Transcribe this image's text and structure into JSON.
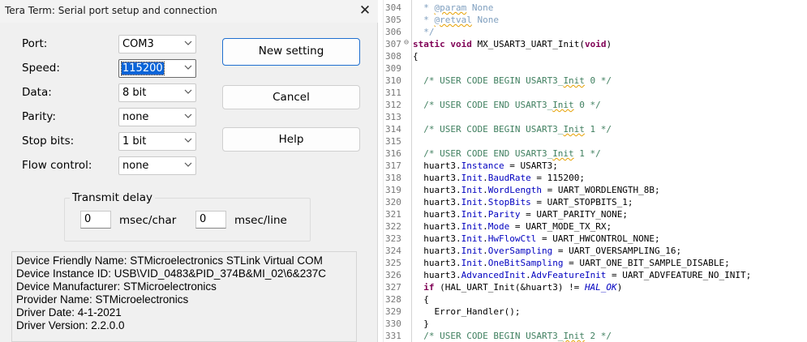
{
  "dialog": {
    "title": "Tera Term: Serial port setup and connection",
    "close_glyph": "✕",
    "fields": [
      {
        "label": "Port:",
        "value": "COM3"
      },
      {
        "label": "Speed:",
        "value": "115200"
      },
      {
        "label": "Data:",
        "value": "8 bit"
      },
      {
        "label": "Parity:",
        "value": "none"
      },
      {
        "label": "Stop bits:",
        "value": "1 bit"
      },
      {
        "label": "Flow control:",
        "value": "none"
      }
    ],
    "buttons": {
      "new_setting": "New setting",
      "cancel": "Cancel",
      "help": "Help"
    },
    "transmit_delay": {
      "title": "Transmit delay",
      "char_value": "0",
      "char_unit": "msec/char",
      "line_value": "0",
      "line_unit": "msec/line"
    },
    "device_info": [
      "Device Friendly Name: STMicroelectronics STLink Virtual COM",
      "Device Instance ID: USB\\VID_0483&PID_374B&MI_02\\6&237C",
      "Device Manufacturer: STMicroelectronics",
      "Provider Name: STMicroelectronics",
      "Driver Date: 4-1-2021",
      "Driver Version: 2.2.0.0"
    ]
  },
  "editor": {
    "line_numbers": [
      "304",
      "305",
      "306",
      "307",
      "308",
      "309",
      "310",
      "311",
      "312",
      "313",
      "314",
      "315",
      "316",
      "317",
      "318",
      "319",
      "320",
      "321",
      "322",
      "323",
      "324",
      "325",
      "326",
      "327",
      "328",
      "329",
      "330",
      "331"
    ],
    "fold_marker": "⊖",
    "lines": {
      "l304_a": "  * ",
      "l304_b": "@param",
      "l304_c": " None",
      "l305_a": "  * ",
      "l305_b": "@retval",
      "l305_c": " None",
      "l306": "  */",
      "l307_kw1": "static",
      "l307_kw2": "void",
      "l307_mid": " MX_USART3_UART_Init(",
      "l307_kw3": "void",
      "l307_end": ")",
      "l308": "{",
      "l310_a": "  /* USER CODE BEGIN USART3_",
      "l310_b": "Init",
      "l310_c": " 0 */",
      "l312_a": "  /* USER CODE END USART3_",
      "l312_b": "Init",
      "l312_c": " 0 */",
      "l314_a": "  /* USER CODE BEGIN USART3_",
      "l314_b": "Init",
      "l314_c": " 1 */",
      "l316_a": "  /* USER CODE END USART3_",
      "l316_b": "Init",
      "l316_c": " 1 */",
      "l317_a": "  huart3.",
      "l317_b": "Instance",
      "l317_c": " = USART3;",
      "l318_a": "  huart3.",
      "l318_b": "Init",
      "l318_c": ".",
      "l318_d": "BaudRate",
      "l318_e": " = 115200;",
      "l319_a": "  huart3.",
      "l319_b": "Init",
      "l319_c": ".",
      "l319_d": "WordLength",
      "l319_e": " = UART_WORDLENGTH_8B;",
      "l320_a": "  huart3.",
      "l320_b": "Init",
      "l320_c": ".",
      "l320_d": "StopBits",
      "l320_e": " = UART_STOPBITS_1;",
      "l321_a": "  huart3.",
      "l321_b": "Init",
      "l321_c": ".",
      "l321_d": "Parity",
      "l321_e": " = UART_PARITY_NONE;",
      "l322_a": "  huart3.",
      "l322_b": "Init",
      "l322_c": ".",
      "l322_d": "Mode",
      "l322_e": " = UART_MODE_TX_RX;",
      "l323_a": "  huart3.",
      "l323_b": "Init",
      "l323_c": ".",
      "l323_d": "HwFlowCtl",
      "l323_e": " = UART_HWCONTROL_NONE;",
      "l324_a": "  huart3.",
      "l324_b": "Init",
      "l324_c": ".",
      "l324_d": "OverSampling",
      "l324_e": " = UART_OVERSAMPLING_16;",
      "l325_a": "  huart3.",
      "l325_b": "Init",
      "l325_c": ".",
      "l325_d": "OneBitSampling",
      "l325_e": " = UART_ONE_BIT_SAMPLE_DISABLE;",
      "l326_a": "  huart3.",
      "l326_b": "AdvancedInit",
      "l326_c": ".",
      "l326_d": "AdvFeatureInit",
      "l326_e": " = UART_ADVFEATURE_NO_INIT;",
      "l327_kw": "if",
      "l327_a": " (HAL_UART_Init(&huart3) != ",
      "l327_b": "HAL_OK",
      "l327_c": ")",
      "l328": "  {",
      "l329": "    Error_Handler();",
      "l330": "  }",
      "l331_a": "  /* USER CODE BEGIN USART3_",
      "l331_b": "Init",
      "l331_c": " 2 */"
    }
  }
}
